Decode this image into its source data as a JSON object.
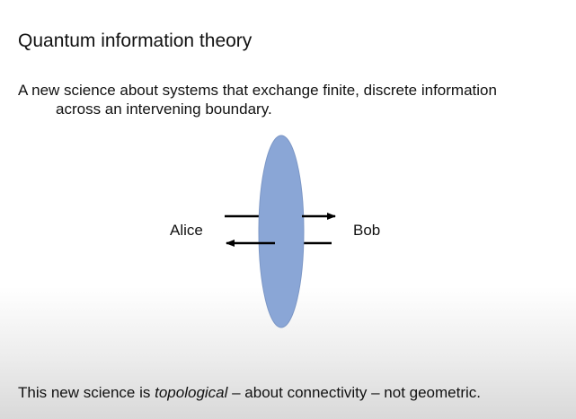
{
  "slide": {
    "title": "Quantum information theory",
    "intro_line1": "A new science about systems that exchange finite, discrete information",
    "intro_line2": "across an intervening boundary."
  },
  "diagram": {
    "left_party": "Alice",
    "right_party": "Bob",
    "boundary_color": "#8aa6d6",
    "arrow_color": "#000000",
    "arrows": [
      {
        "direction": "left-to-right"
      },
      {
        "direction": "right-to-left"
      }
    ]
  },
  "footer": {
    "prefix": "This new science is ",
    "emphasis": "topological",
    "suffix": " – about connectivity – not geometric."
  }
}
